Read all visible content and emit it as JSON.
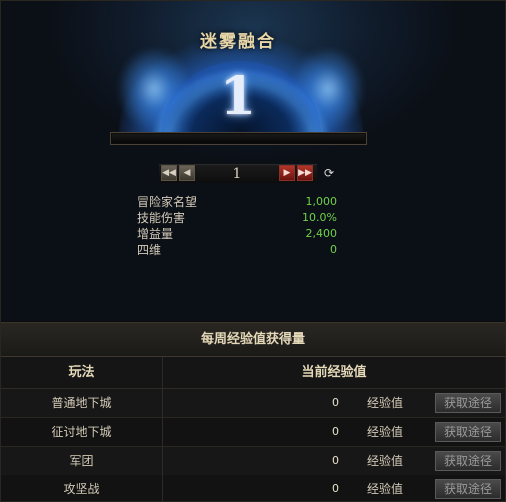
{
  "header": {
    "title": "迷雾融合",
    "level": "1",
    "progress_fraction": 0
  },
  "stepper": {
    "first_icon": "double-left-arrow-icon",
    "prev_icon": "left-arrow-icon",
    "value": "1",
    "next_icon": "right-arrow-icon",
    "last_icon": "double-right-arrow-icon",
    "refresh_icon": "refresh-icon",
    "first_glyph": "◀◀",
    "prev_glyph": "◀",
    "next_glyph": "▶",
    "last_glyph": "▶▶",
    "refresh_glyph": "⟳"
  },
  "stats": [
    {
      "label": "冒险家名望",
      "value": "1,000"
    },
    {
      "label": "技能伤害",
      "value": "10.0%"
    },
    {
      "label": "增益量",
      "value": "2,400"
    },
    {
      "label": "四维",
      "value": "0"
    }
  ],
  "weekly": {
    "title": "每周经验值获得量",
    "col_mode": "玩法",
    "col_exp": "当前经验值",
    "rows": [
      {
        "mode": "普通地下城",
        "value": "0",
        "unit": "经验值",
        "button": "获取途径"
      },
      {
        "mode": "征讨地下城",
        "value": "0",
        "unit": "经验值",
        "button": "获取途径"
      },
      {
        "mode": "军团",
        "value": "0",
        "unit": "经验值",
        "button": "获取途径"
      },
      {
        "mode": "攻坚战",
        "value": "0",
        "unit": "经验值",
        "button": "获取途径"
      }
    ]
  },
  "colors": {
    "title_gold": "#e8d6a8",
    "stat_green": "#6fd24a",
    "button_red": "#b3342a"
  }
}
